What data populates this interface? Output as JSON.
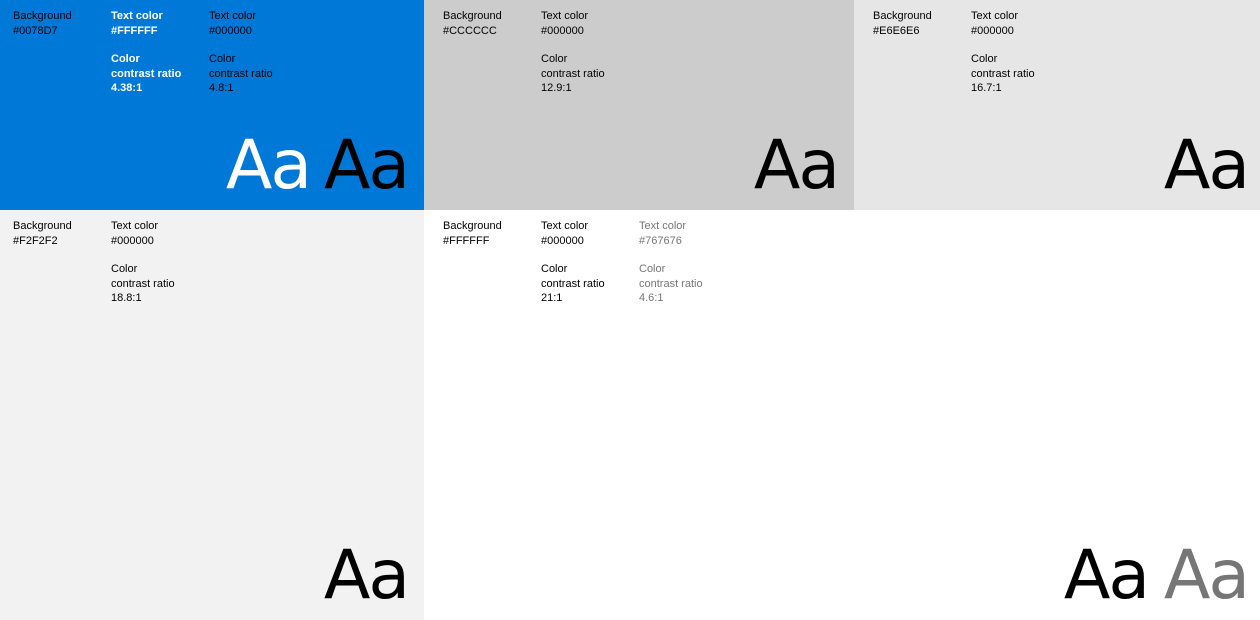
{
  "swatches": [
    {
      "background_label": "Background",
      "background_hex": "#0078D7",
      "text_colors": [
        {
          "label": "Text color",
          "hex": "#FFFFFF",
          "ratio_label_1": "Color",
          "ratio_label_2": "contrast ratio",
          "ratio": "4.38:1"
        },
        {
          "label": "Text color",
          "hex": "#000000",
          "ratio_label_1": "Color",
          "ratio_label_2": "contrast ratio",
          "ratio": "4.8:1"
        }
      ],
      "samples": [
        "Aa",
        "Aa"
      ]
    },
    {
      "background_label": "Background",
      "background_hex": "#CCCCCC",
      "text_colors": [
        {
          "label": "Text color",
          "hex": "#000000",
          "ratio_label_1": "Color",
          "ratio_label_2": "contrast ratio",
          "ratio": "12.9:1"
        }
      ],
      "samples": [
        "Aa"
      ]
    },
    {
      "background_label": "Background",
      "background_hex": "#E6E6E6",
      "text_colors": [
        {
          "label": "Text color",
          "hex": "#000000",
          "ratio_label_1": "Color",
          "ratio_label_2": "contrast ratio",
          "ratio": "16.7:1"
        }
      ],
      "samples": [
        "Aa"
      ]
    },
    {
      "background_label": "Background",
      "background_hex": "#F2F2F2",
      "text_colors": [
        {
          "label": "Text color",
          "hex": "#000000",
          "ratio_label_1": "Color",
          "ratio_label_2": "contrast ratio",
          "ratio": "18.8:1"
        }
      ],
      "samples": [
        "Aa"
      ]
    },
    {
      "background_label": "Background",
      "background_hex": "#FFFFFF",
      "text_colors": [
        {
          "label": "Text color",
          "hex": "#000000",
          "ratio_label_1": "Color",
          "ratio_label_2": "contrast ratio",
          "ratio": "21:1"
        },
        {
          "label": "Text color",
          "hex": "#767676",
          "ratio_label_1": "Color",
          "ratio_label_2": "contrast ratio",
          "ratio": "4.6:1"
        }
      ],
      "samples": [
        "Aa",
        "Aa"
      ]
    }
  ]
}
